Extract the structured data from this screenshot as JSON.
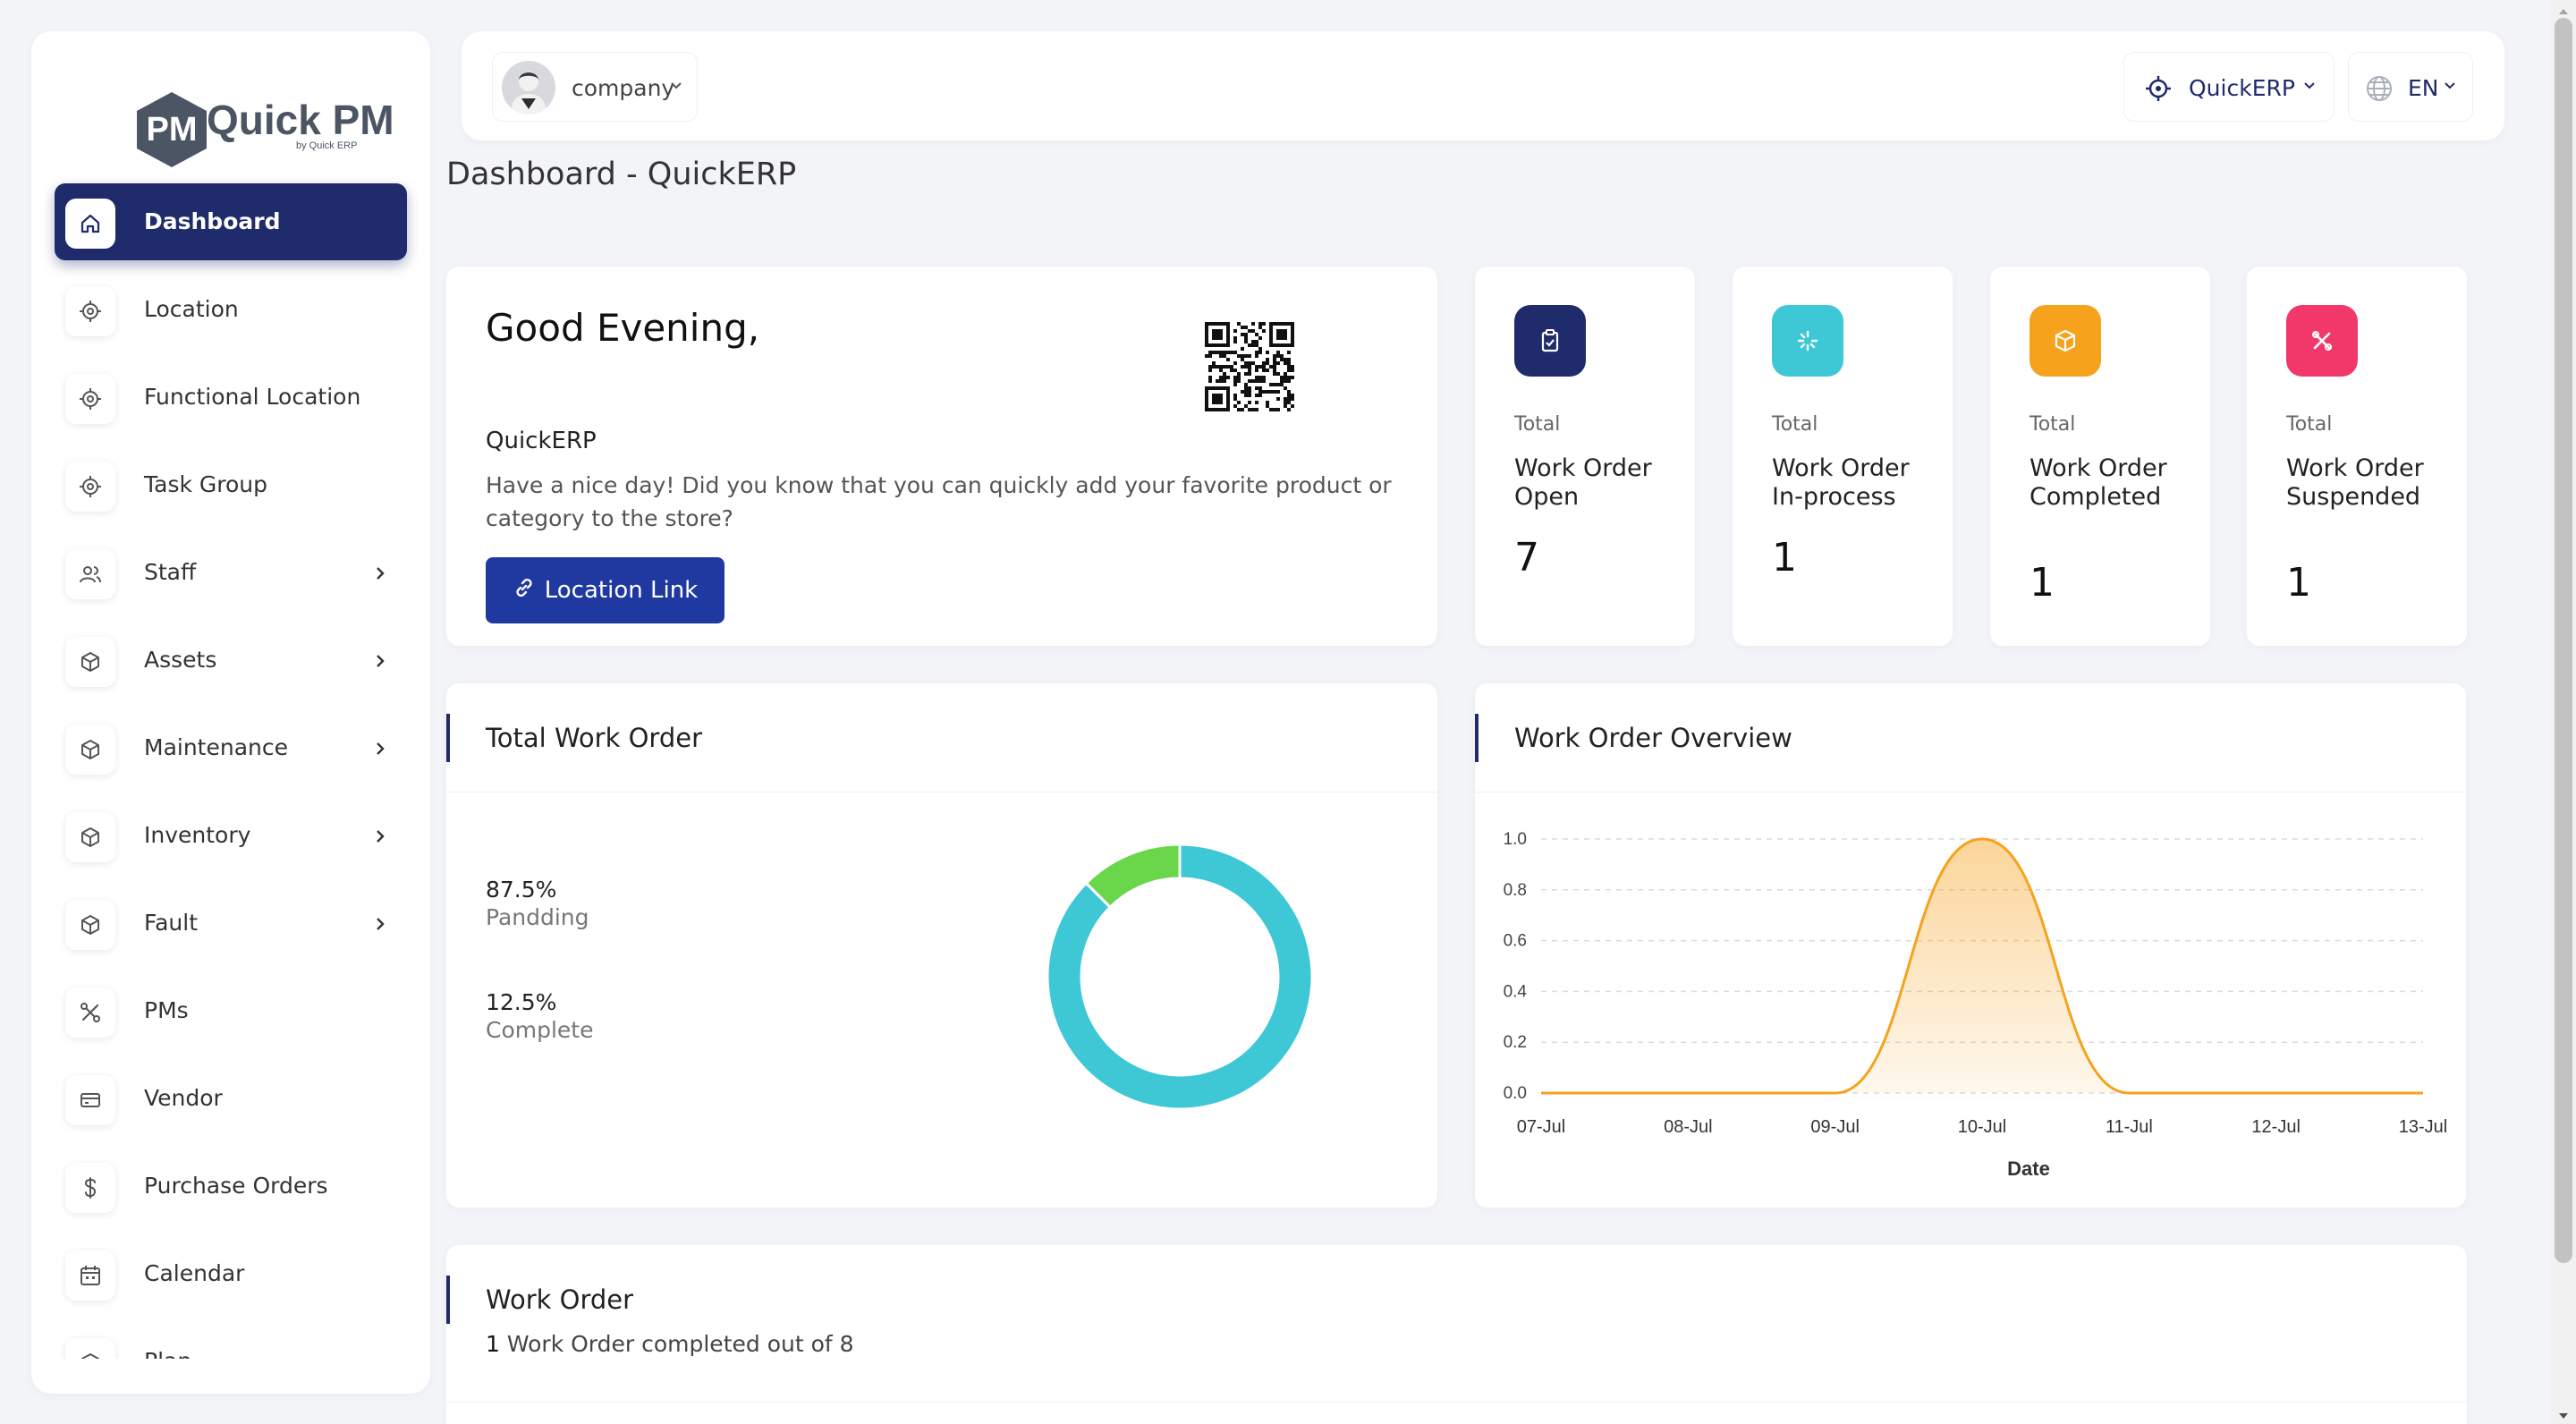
{
  "logo": {
    "mark": "PM",
    "name": "Quick PM",
    "sub": "by Quick ERP"
  },
  "sidebar": {
    "items": [
      {
        "label": "Dashboard",
        "icon": "home-icon",
        "active": true,
        "has_children": false
      },
      {
        "label": "Location",
        "icon": "target-icon",
        "has_children": false
      },
      {
        "label": "Functional Location",
        "icon": "target-icon",
        "has_children": false
      },
      {
        "label": "Task Group",
        "icon": "target-icon",
        "has_children": false
      },
      {
        "label": "Staff",
        "icon": "users-icon",
        "has_children": true
      },
      {
        "label": "Assets",
        "icon": "box-icon",
        "has_children": true
      },
      {
        "label": "Maintenance",
        "icon": "box-icon",
        "has_children": true
      },
      {
        "label": "Inventory",
        "icon": "box-icon",
        "has_children": true
      },
      {
        "label": "Fault",
        "icon": "box-icon",
        "has_children": true
      },
      {
        "label": "PMs",
        "icon": "tools-icon",
        "has_children": false
      },
      {
        "label": "Vendor",
        "icon": "card-icon",
        "has_children": false
      },
      {
        "label": "Purchase Orders",
        "icon": "dollar-icon",
        "has_children": false
      },
      {
        "label": "Calendar",
        "icon": "calendar-icon",
        "has_children": false
      },
      {
        "label": "Plan",
        "icon": "box-icon",
        "has_children": false
      }
    ]
  },
  "topbar": {
    "company": "company",
    "org": "QuickERP",
    "lang": "EN"
  },
  "page_title": "Dashboard - QuickERP",
  "welcome": {
    "greeting": "Good Evening,",
    "company": "QuickERP",
    "message": "Have a nice day! Did you know that you can quickly add your favorite product or category to the store?",
    "button": "Location Link"
  },
  "stats": [
    {
      "total": "Total",
      "title": "Work Order Open",
      "value": "7",
      "color": "#1f2b6b",
      "icon": "clipboard-icon"
    },
    {
      "total": "Total",
      "title": "Work Order In-process",
      "value": "1",
      "color": "#3ec8d6",
      "icon": "spinner-icon"
    },
    {
      "total": "Total",
      "title": "Work Order Completed",
      "value": "1",
      "color": "#f6a21c",
      "icon": "box-icon"
    },
    {
      "total": "Total",
      "title": "Work Order Suspended",
      "value": "1",
      "color": "#f2386b",
      "icon": "tools-icon"
    }
  ],
  "total_work_order": {
    "title": "Total Work Order",
    "legend": [
      {
        "pct": "87.5%",
        "name": "Pandding"
      },
      {
        "pct": "12.5%",
        "name": "Complete"
      }
    ]
  },
  "overview": {
    "title": "Work Order Overview"
  },
  "work_order": {
    "title": "Work Order",
    "count": "1",
    "text": "Work Order completed out of 8"
  },
  "chart_data": [
    {
      "type": "pie",
      "title": "Total Work Order",
      "categories": [
        "Pandding",
        "Complete"
      ],
      "values": [
        87.5,
        12.5
      ],
      "colors": [
        "#3ec8d6",
        "#6ad64a"
      ]
    },
    {
      "type": "area",
      "title": "Work Order Overview",
      "xlabel": "Date",
      "ylabel": "",
      "categories": [
        "07-Jul",
        "08-Jul",
        "09-Jul",
        "10-Jul",
        "11-Jul",
        "12-Jul",
        "13-Jul"
      ],
      "values": [
        0,
        0,
        0,
        1,
        0,
        0,
        0
      ],
      "ylim": [
        0,
        1
      ],
      "yticks": [
        "0.0",
        "0.2",
        "0.4",
        "0.6",
        "0.8",
        "1.0"
      ],
      "grid": true,
      "color": "#f6a21c"
    }
  ]
}
